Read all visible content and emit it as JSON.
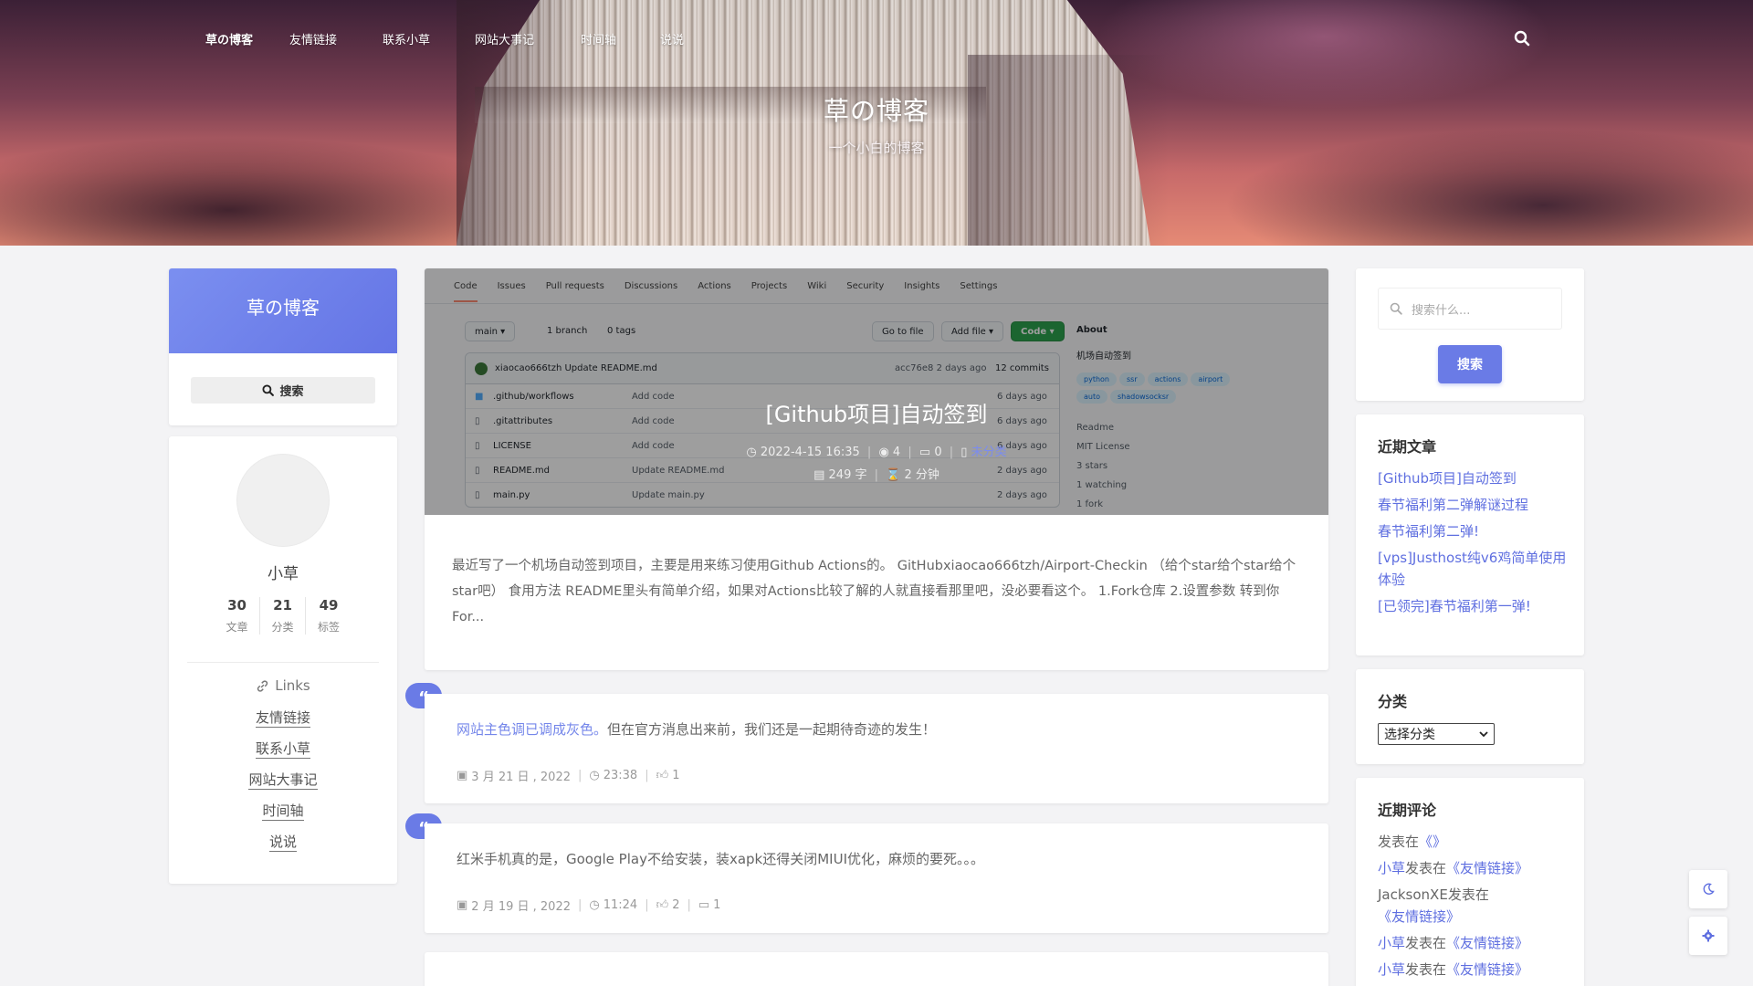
{
  "nav": {
    "brand": "草の博客",
    "items": [
      "友情链接",
      "联系小草",
      "网站大事记",
      "时间轴",
      "说说"
    ]
  },
  "hero": {
    "title": "草の博客",
    "subtitle": "一个小白的博客"
  },
  "site_card": {
    "title": "草の博客",
    "search_label": "搜索"
  },
  "profile": {
    "name": "小草",
    "stats": [
      {
        "num": "30",
        "label": "文章"
      },
      {
        "num": "21",
        "label": "分类"
      },
      {
        "num": "49",
        "label": "标签"
      }
    ],
    "links_title": "Links",
    "links": [
      "友情链接",
      "联系小草",
      "网站大事记",
      "时间轴",
      "说说"
    ]
  },
  "post": {
    "title": "[Github项目]自动签到",
    "date": "2022-4-15 16:35",
    "views": "4",
    "comments": "0",
    "category": "未分类",
    "words": "249 字",
    "read_time": "2 分钟",
    "excerpt": "最近写了一个机场自动签到项目，主要是用来练习使用Github Actions的。 GitHubxiaocao666tzh/Airport-Checkin   （给个star给个star给个star吧） 食用方法 README里头有简单介绍，如果对Actions比较了解的人就直接看那里吧，没必要看这个。 1.Fork仓库 2.设置参数 转到你For...",
    "thumb": {
      "tabs": [
        "Code",
        "Issues",
        "Pull requests",
        "Discussions",
        "Actions",
        "Projects",
        "Wiki",
        "Security",
        "Insights",
        "Settings"
      ],
      "branch": "main",
      "branches": "1 branch",
      "tags": "0 tags",
      "goto": "Go to file",
      "addfile": "Add file",
      "code": "Code",
      "commit_user": "xiaocao666tzh",
      "commit_msg": "Update README.md",
      "commit_hash": "acc76e8",
      "commit_time": "2 days ago",
      "commits": "12 commits",
      "files": [
        {
          "name": ".github/workflows",
          "msg": "Add code",
          "time": "6 days ago"
        },
        {
          "name": ".gitattributes",
          "msg": "Add code",
          "time": "6 days ago"
        },
        {
          "name": "LICENSE",
          "msg": "Add code",
          "time": "6 days ago"
        },
        {
          "name": "README.md",
          "msg": "Update README.md",
          "time": "2 days ago"
        },
        {
          "name": "main.py",
          "msg": "Update main.py",
          "time": "2 days ago"
        }
      ],
      "about_title": "About",
      "about_desc": "机场自动签到",
      "topics": [
        "python",
        "ssr",
        "actions",
        "airport",
        "auto",
        "shadowsocksr"
      ],
      "about_items": [
        "Readme",
        "MIT License",
        "3 stars",
        "1 watching",
        "1 fork"
      ]
    }
  },
  "says": [
    {
      "prefix": "网站主色调已调成灰色。",
      "text": "但在官方消息出来前，我们还是一起期待奇迹的发生！",
      "date": "3 月 21 日 , 2022",
      "time": "23:38",
      "likes": "1",
      "comments": ""
    },
    {
      "prefix": "",
      "text": "红米手机真的是，Google Play不给安装，装xapk还得关闭MIUI优化，麻烦的要死。。。",
      "date": "2 月 19 日 , 2022",
      "time": "11:24",
      "likes": "2",
      "comments": "1"
    }
  ],
  "sidebar": {
    "search_placeholder": "搜索什么...",
    "search_button": "搜索",
    "recent_title": "近期文章",
    "recent": [
      "[Github项目]自动签到",
      "春节福利第二弹解谜过程",
      "春节福利第二弹!",
      "[vps]Justhost纯v6鸡简单使用体验",
      "[已领完]春节福利第一弹!"
    ],
    "category_title": "分类",
    "category_select": "选择分类",
    "comments_title": "近期评论",
    "comments": [
      {
        "who": "",
        "pre": "发表在",
        "post": "《》"
      },
      {
        "who": "小草",
        "pre": "发表在",
        "post": "《友情链接》"
      },
      {
        "who": "JacksonXE",
        "pre": "发表在",
        "post": "《友情链接》"
      },
      {
        "who": "小草",
        "pre": "发表在",
        "post": "《友情链接》"
      },
      {
        "who": "小草",
        "pre": "发表在",
        "post": "《友情链接》"
      }
    ]
  }
}
